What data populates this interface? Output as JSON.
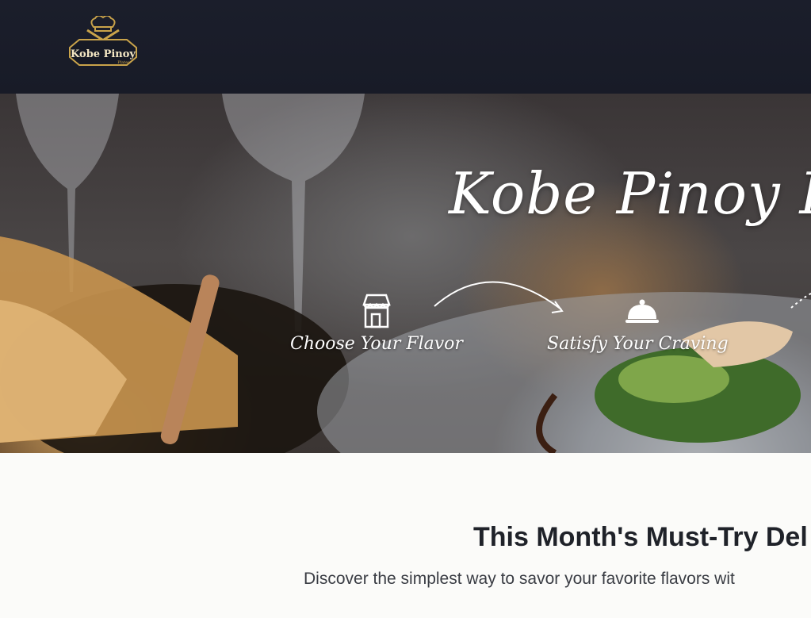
{
  "brand": {
    "logo_text": "Kobe Pinoy",
    "logo_subtext": "Plates"
  },
  "hero": {
    "title": "Kobe Pinoy Pla",
    "steps": [
      {
        "label": "Choose Your Flavor",
        "icon": "storefront-icon"
      },
      {
        "label": "Satisfy Your Craving",
        "icon": "serving-cloche-icon"
      }
    ]
  },
  "featured": {
    "title": "This Month's Must-Try Del",
    "subtitle": "Discover the simplest way to savor your favorite flavors wit"
  },
  "colors": {
    "topbar": "#1b1e2b",
    "logo_gold": "#c9a34a",
    "page_bg": "#fbfbf9"
  }
}
